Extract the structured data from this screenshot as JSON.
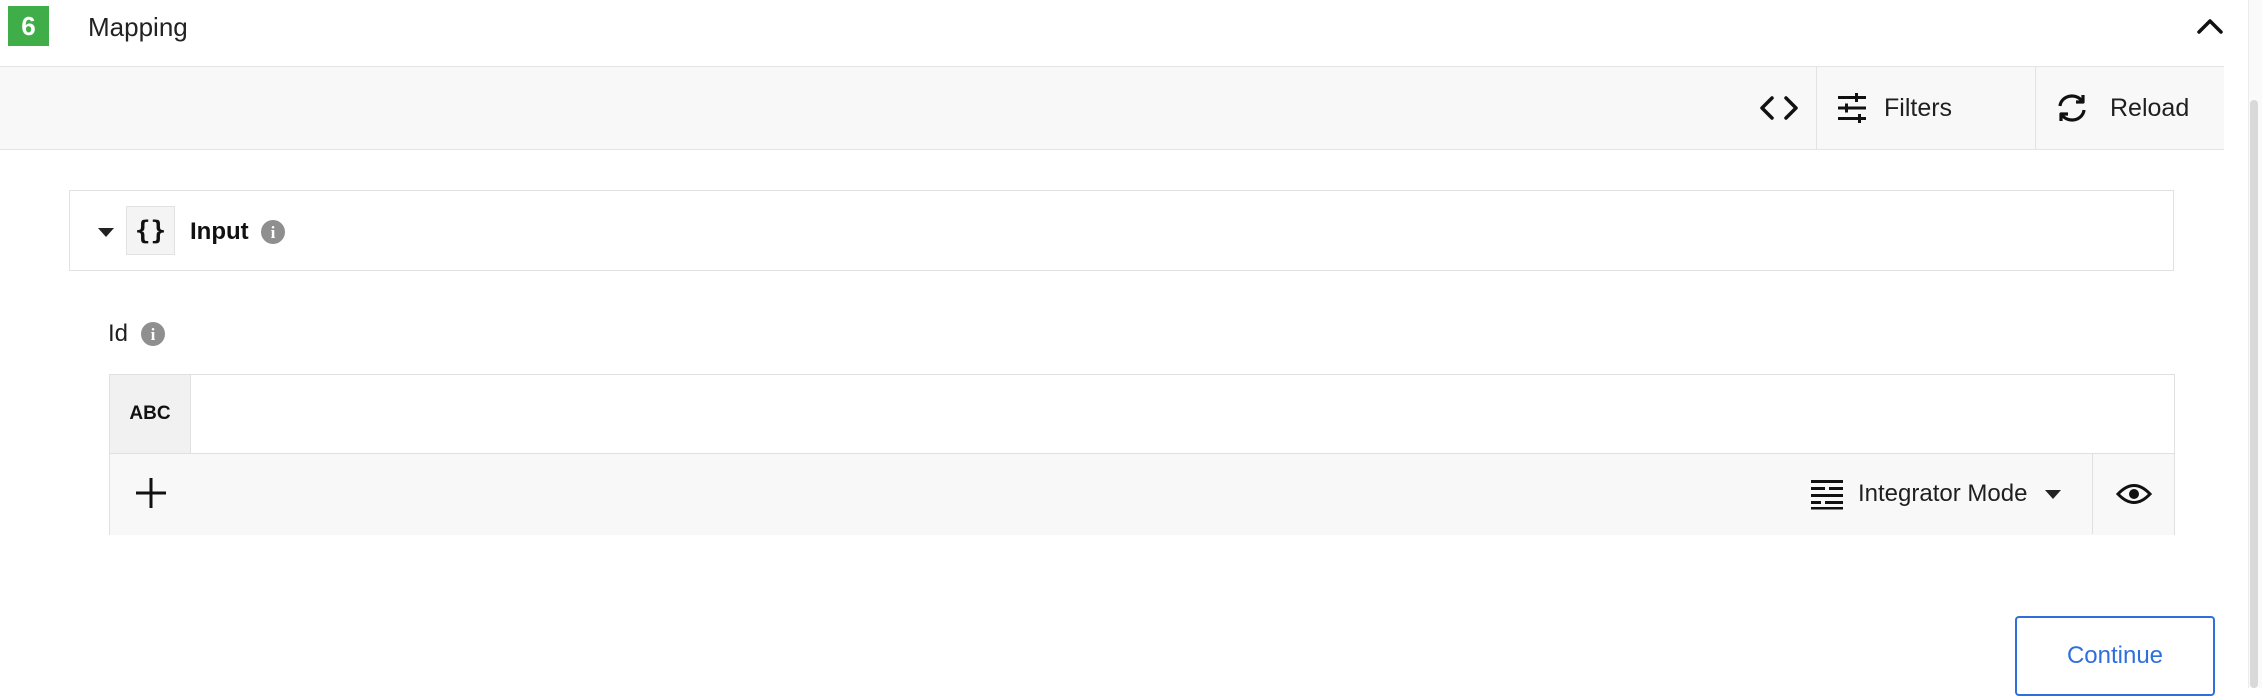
{
  "step": {
    "number": "6",
    "title": "Mapping"
  },
  "toolbar": {
    "code_icon": "code-brackets-icon",
    "filters_label": "Filters",
    "reload_label": "Reload"
  },
  "input_panel": {
    "title": "Input",
    "object_icon_glyph": "{}"
  },
  "id_field": {
    "label": "Id",
    "type_badge": "ABC",
    "value": "",
    "placeholder": "",
    "mode_label": "Integrator Mode"
  },
  "actions": {
    "continue_label": "Continue"
  },
  "colors": {
    "step_badge": "#3fae49",
    "accent": "#2f6fdc"
  }
}
